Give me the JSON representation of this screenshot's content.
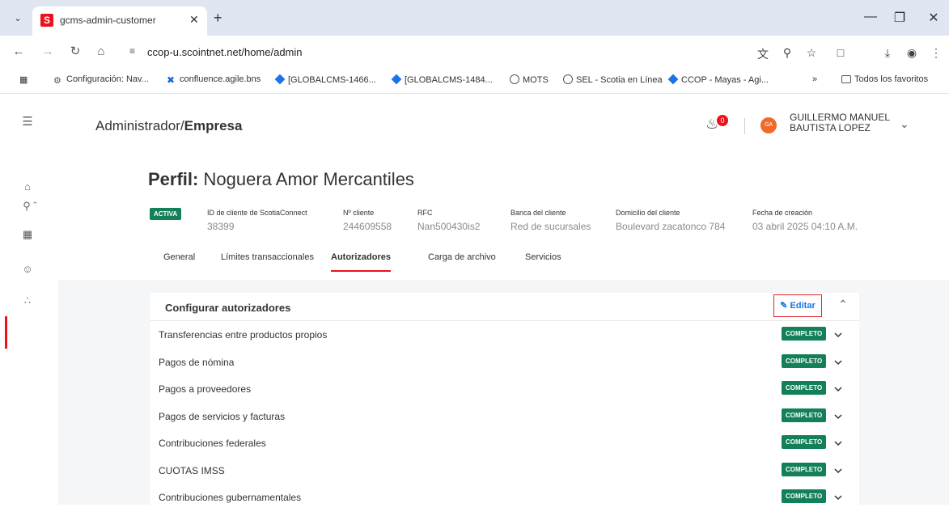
{
  "browser": {
    "tab_title": "gcms-admin-customer",
    "favicon_letter": "S",
    "url": "ccop-u.scointnet.net/home/admin",
    "bookmarks": [
      {
        "label": "Configuración: Nav...",
        "icon": "gear-icon"
      },
      {
        "label": "confluence.agile.bns",
        "icon": "confluence-icon"
      },
      {
        "label": "[GLOBALCMS-1466...",
        "icon": "jira-icon"
      },
      {
        "label": "[GLOBALCMS-1484...",
        "icon": "jira-icon"
      },
      {
        "label": "MOTS",
        "icon": "globe-icon"
      },
      {
        "label": "SEL - Scotia en Línea",
        "icon": "globe-icon"
      },
      {
        "label": "CCOP - Mayas - Agi...",
        "icon": "jira-icon"
      }
    ],
    "all_bookmarks_label": "Todos los favoritos"
  },
  "header": {
    "breadcrumb_prefix": "Administrador/",
    "breadcrumb_current": "Empresa",
    "notification_count": "0",
    "avatar_initials": "GA",
    "user_name_line1": "GUILLERMO MANUEL",
    "user_name_line2": "BAUTISTA LOPEZ"
  },
  "profile": {
    "title_prefix": "Perfil:",
    "title_name": "Noguera Amor Mercantiles",
    "status": "ACTIVA",
    "fields": [
      {
        "label": "ID de cliente de ScotiaConnect",
        "value": "38399"
      },
      {
        "label": "Nº cliente",
        "value": "244609558"
      },
      {
        "label": "RFC",
        "value": "Nan500430is2"
      },
      {
        "label": "Banca del cliente",
        "value": "Red de sucursales"
      },
      {
        "label": "Domicilio del cliente",
        "value": "Boulevard zacatonco 784"
      },
      {
        "label": "Fecha de creación",
        "value": "03 abril 2025 04:10 A.M."
      }
    ]
  },
  "tabs": [
    {
      "label": "General"
    },
    {
      "label": "Límites transaccionales"
    },
    {
      "label": "Autorizadores"
    },
    {
      "label": "Carga de archivo"
    },
    {
      "label": "Servicios"
    }
  ],
  "card": {
    "title": "Configurar autorizadores",
    "edit_label": "Editar",
    "rows": [
      {
        "label": "Transferencias entre productos propios",
        "status": "COMPLETO"
      },
      {
        "label": "Pagos de nómina",
        "status": "COMPLETO"
      },
      {
        "label": "Pagos a proveedores",
        "status": "COMPLETO"
      },
      {
        "label": "Pagos de servicios y facturas",
        "status": "COMPLETO"
      },
      {
        "label": "Contribuciones federales",
        "status": "COMPLETO"
      },
      {
        "label": "CUOTAS IMSS",
        "status": "COMPLETO"
      },
      {
        "label": "Contribuciones gubernamentales",
        "status": "COMPLETO"
      }
    ]
  },
  "colors": {
    "brand_red": "#ec111a",
    "status_green": "#138058",
    "link_blue": "#1a73e8"
  }
}
